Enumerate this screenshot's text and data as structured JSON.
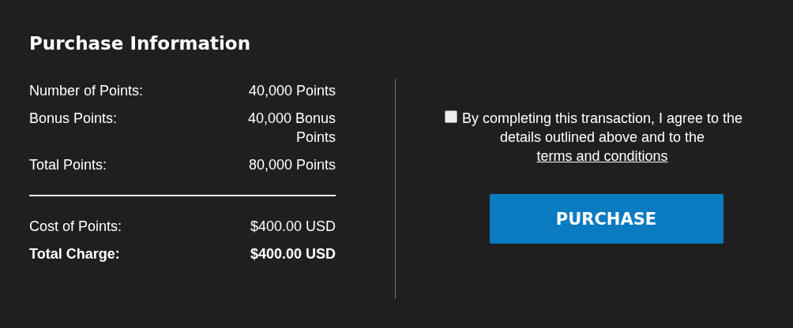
{
  "title": "Purchase Information",
  "groups": [
    [
      {
        "label": "Number of Points:",
        "value": "40,000 Points",
        "kind": "normal"
      },
      {
        "label": "Bonus Points:",
        "value": "40,000 Bonus Points",
        "kind": "normal"
      },
      {
        "label": "Total Points:",
        "value": "80,000 Points",
        "kind": "normal"
      }
    ],
    [
      {
        "label": "Cost of Points:",
        "value": "$400.00 USD",
        "kind": "normal"
      },
      {
        "label": "Total Charge:",
        "value": "$400.00 USD",
        "kind": "total"
      }
    ]
  ],
  "agreement": {
    "checked": false,
    "text": "By completing this transaction, I agree to the details outlined above and to the",
    "link": "terms and conditions"
  },
  "button": "PURCHASE"
}
